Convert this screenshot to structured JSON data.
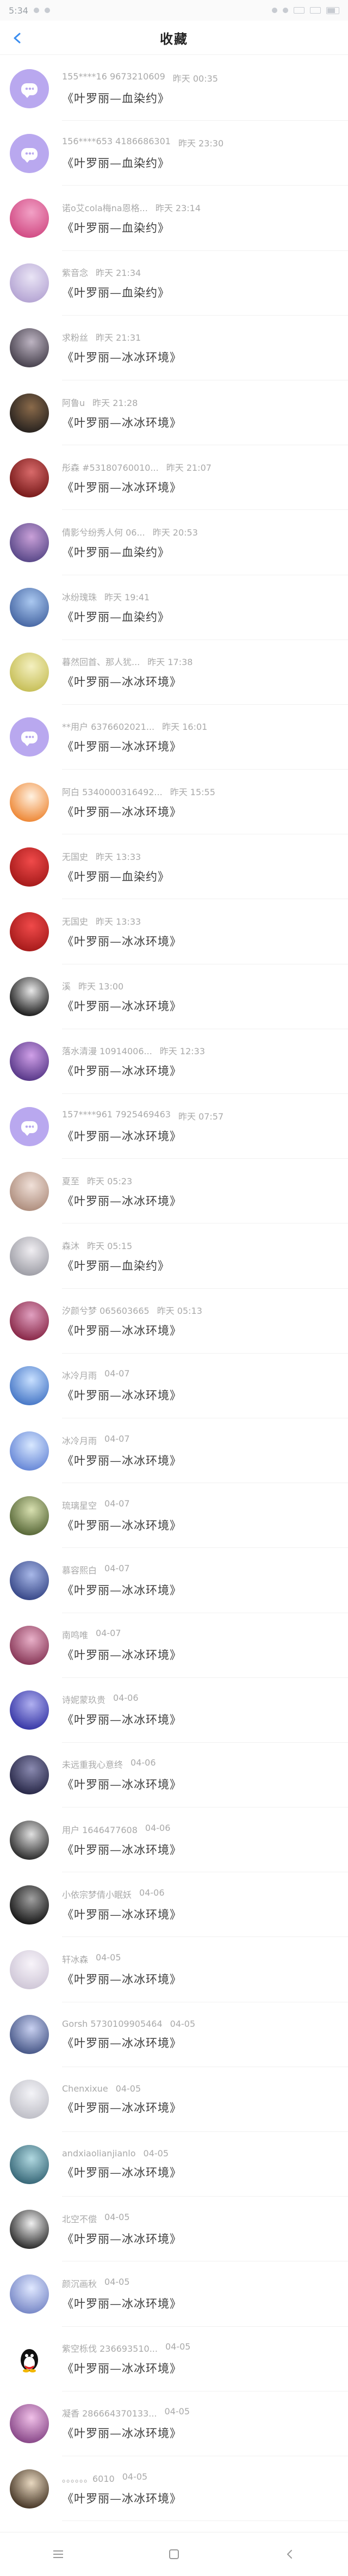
{
  "status": {
    "time": "5:34"
  },
  "header": {
    "title": "收藏"
  },
  "items": [
    {
      "name": "155****16 9673210609",
      "time": "昨天 00:35",
      "msg": "《叶罗丽—血染约》",
      "avatar_type": "chat"
    },
    {
      "name": "156****653 4186686301",
      "time": "昨天 23:30",
      "msg": "《叶罗丽—血染约》",
      "avatar_type": "chat"
    },
    {
      "name": "诺o艾cola梅na恩格...",
      "time": "昨天 23:14",
      "msg": "《叶罗丽—血染约》",
      "avatar_type": "img",
      "c1": "#d24e86",
      "c2": "#f2a1c6"
    },
    {
      "name": "紫音念",
      "time": "昨天 21:34",
      "msg": "《叶罗丽—血染约》",
      "avatar_type": "img",
      "c1": "#b6a6d4",
      "c2": "#e9e4f5"
    },
    {
      "name": "求粉丝",
      "time": "昨天 21:31",
      "msg": "《叶罗丽—冰冰环境》",
      "avatar_type": "img",
      "c1": "#4a4450",
      "c2": "#bdb4c2"
    },
    {
      "name": "阿鲁u",
      "time": "昨天 21:28",
      "msg": "《叶罗丽—冰冰环境》",
      "avatar_type": "img",
      "c1": "#2a2420",
      "c2": "#8a6a4a"
    },
    {
      "name": "彤森 #53180760010...",
      "time": "昨天 21:07",
      "msg": "《叶罗丽—冰冰环境》",
      "avatar_type": "img",
      "c1": "#7a1c1c",
      "c2": "#d86a6a"
    },
    {
      "name": "倩影兮纷秀人何 06...",
      "time": "昨天 20:53",
      "msg": "《叶罗丽—血染约》",
      "avatar_type": "img",
      "c1": "#5b4a8a",
      "c2": "#c9a0d8"
    },
    {
      "name": "冰纷瑰珠",
      "time": "昨天 19:41",
      "msg": "《叶罗丽—血染约》",
      "avatar_type": "img",
      "c1": "#4a6aa6",
      "c2": "#aac8f0"
    },
    {
      "name": "暮然回首、那人犹...",
      "time": "昨天 17:38",
      "msg": "《叶罗丽—冰冰环境》",
      "avatar_type": "img",
      "c1": "#c8c05a",
      "c2": "#f4f0c0"
    },
    {
      "name": "**用户 6376602021...",
      "time": "昨天 16:01",
      "msg": "《叶罗丽—冰冰环境》",
      "avatar_type": "chat"
    },
    {
      "name": "阿白 5340000316492...",
      "time": "昨天 15:55",
      "msg": "《叶罗丽—冰冰环境》",
      "avatar_type": "img",
      "c1": "#ee8a3a",
      "c2": "#fff1e0"
    },
    {
      "name": "无国史",
      "time": "昨天 13:33",
      "msg": "《叶罗丽—血染约》",
      "avatar_type": "img",
      "c1": "#a81c1c",
      "c2": "#f04a4a"
    },
    {
      "name": "无国史",
      "time": "昨天 13:33",
      "msg": "《叶罗丽—冰冰环境》",
      "avatar_type": "img",
      "c1": "#a81c1c",
      "c2": "#f04a4a"
    },
    {
      "name": "溪",
      "time": "昨天 13:00",
      "msg": "《叶罗丽—冰冰环境》",
      "avatar_type": "img",
      "c1": "#202020",
      "c2": "#e8e8e8"
    },
    {
      "name": "落水清漫 10914006...",
      "time": "昨天 12:33",
      "msg": "《叶罗丽—冰冰环境》",
      "avatar_type": "img",
      "c1": "#5a3a8a",
      "c2": "#d0a0e8"
    },
    {
      "name": "157****961 7925469463",
      "time": "昨天 07:57",
      "msg": "《叶罗丽—冰冰环境》",
      "avatar_type": "chat"
    },
    {
      "name": "夏至",
      "time": "昨天 05:23",
      "msg": "《叶罗丽—冰冰环境》",
      "avatar_type": "img",
      "c1": "#b09080",
      "c2": "#f0e0d8"
    },
    {
      "name": "森沐",
      "time": "昨天 05:15",
      "msg": "《叶罗丽—血染约》",
      "avatar_type": "img",
      "c1": "#a0a0a8",
      "c2": "#f0eef2"
    },
    {
      "name": "汐颜兮梦 065603665",
      "time": "昨天 05:13",
      "msg": "《叶罗丽—冰冰环境》",
      "avatar_type": "img",
      "c1": "#8a2a4a",
      "c2": "#e0a0c0"
    },
    {
      "name": "冰冷月雨",
      "time": "04-07",
      "msg": "《叶罗丽—冰冰环境》",
      "avatar_type": "img",
      "c1": "#4a7ac8",
      "c2": "#c8e0ff"
    },
    {
      "name": "冰冷月雨",
      "time": "04-07",
      "msg": "《叶罗丽—冰冰环境》",
      "avatar_type": "img",
      "c1": "#6a8ad8",
      "c2": "#d8e8ff"
    },
    {
      "name": "琉璃星空",
      "time": "04-07",
      "msg": "《叶罗丽—冰冰环境》",
      "avatar_type": "img",
      "c1": "#5a6a3a",
      "c2": "#d8e0b0"
    },
    {
      "name": "慕容熙白",
      "time": "04-07",
      "msg": "《叶罗丽—冰冰环境》",
      "avatar_type": "img",
      "c1": "#3a4a8a",
      "c2": "#a8b8e8"
    },
    {
      "name": "南鸣唯",
      "time": "04-07",
      "msg": "《叶罗丽—冰冰环境》",
      "avatar_type": "img",
      "c1": "#8a3a5a",
      "c2": "#e8b0c8"
    },
    {
      "name": "诗妮蒙玖贵",
      "time": "04-06",
      "msg": "《叶罗丽—冰冰环境》",
      "avatar_type": "img",
      "c1": "#3a3aa8",
      "c2": "#b0b0f0"
    },
    {
      "name": "未远重我心意终",
      "time": "04-06",
      "msg": "《叶罗丽—冰冰环境》",
      "avatar_type": "img",
      "c1": "#2a2a4a",
      "c2": "#8a8ab0"
    },
    {
      "name": "用户 1646477608",
      "time": "04-06",
      "msg": "《叶罗丽—冰冰环境》",
      "avatar_type": "img",
      "c1": "#303030",
      "c2": "#e0e0e0"
    },
    {
      "name": "小依宗梦倩小眠妖",
      "time": "04-06",
      "msg": "《叶罗丽—冰冰环境》",
      "avatar_type": "img",
      "c1": "#1a1a1a",
      "c2": "#a0a0a0"
    },
    {
      "name": "轩冰森",
      "time": "04-05",
      "msg": "《叶罗丽—冰冰环境》",
      "avatar_type": "img",
      "c1": "#d0c8d8",
      "c2": "#f8f4fa"
    },
    {
      "name": "Gorsh 5730109905464",
      "time": "04-05",
      "msg": "《叶罗丽—冰冰环境》",
      "avatar_type": "img",
      "c1": "#4a5a8a",
      "c2": "#c8d0f0"
    },
    {
      "name": "Chenxixue",
      "time": "04-05",
      "msg": "《叶罗丽—冰冰环境》",
      "avatar_type": "img",
      "c1": "#c0c0c8",
      "c2": "#f4f4f8"
    },
    {
      "name": "andxiaolianjianlo",
      "time": "04-05",
      "msg": "《叶罗丽—冰冰环境》",
      "avatar_type": "img",
      "c1": "#3a6a7a",
      "c2": "#b0d8e0"
    },
    {
      "name": "北空不偿",
      "time": "04-05",
      "msg": "《叶罗丽—冰冰环境》",
      "avatar_type": "img",
      "c1": "#303030",
      "c2": "#f0f0f0"
    },
    {
      "name": "颜沉画秋",
      "time": "04-05",
      "msg": "《叶罗丽—冰冰环境》",
      "avatar_type": "img",
      "c1": "#7a8ac8",
      "c2": "#e0e8ff"
    },
    {
      "name": "紫空栎伐 236693510...",
      "time": "04-05",
      "msg": "《叶罗丽—冰冰环境》",
      "avatar_type": "qq"
    },
    {
      "name": "凝香 286664370133...",
      "time": "04-05",
      "msg": "《叶罗丽—冰冰环境》",
      "avatar_type": "img",
      "c1": "#8a4a8a",
      "c2": "#f0c0e8"
    },
    {
      "name": "。。。。。。6010",
      "time": "04-05",
      "msg": "《叶罗丽—冰冰环境》",
      "avatar_type": "img",
      "c1": "#4a3a2a",
      "c2": "#e8d8c0"
    }
  ],
  "nav": {
    "menu": "menu-icon",
    "home": "home-icon",
    "back": "back-icon"
  }
}
